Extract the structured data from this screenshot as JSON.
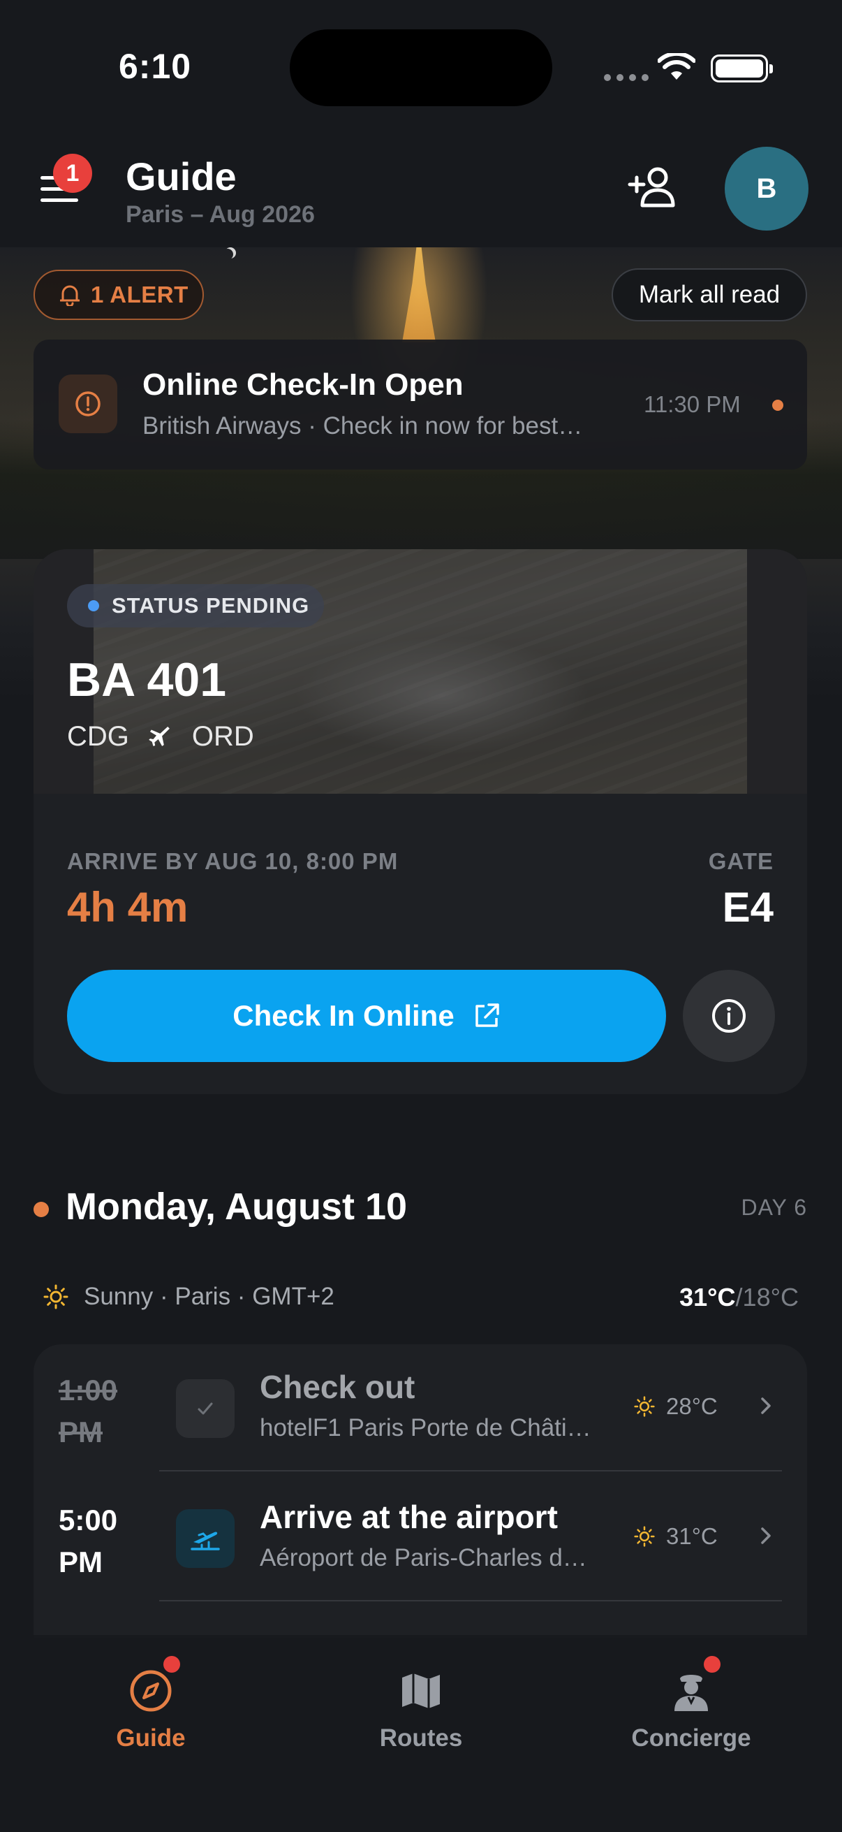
{
  "status_bar": {
    "time": "6:10"
  },
  "header": {
    "title": "Guide",
    "subtitle": "Paris – Aug 2026",
    "menu_badge": "1",
    "avatar_initial": "B"
  },
  "alerts": {
    "pill_label": "1 ALERT",
    "mark_all_label": "Mark all read"
  },
  "notification": {
    "title": "Online Check-In Open",
    "subtitle": "British Airways · Check in now for best…",
    "time": "11:30 PM",
    "dot_color": "#e57f45"
  },
  "flight": {
    "status": "STATUS PENDING",
    "flight_number": "BA 401",
    "origin": "CDG",
    "destination": "ORD",
    "arrive_label": "ARRIVE BY AUG 10, 8:00 PM",
    "countdown": "4h 4m",
    "gate_label": "GATE",
    "gate": "E4",
    "checkin_label": "Check In Online"
  },
  "day": {
    "title": "Monday, August 10",
    "day_label": "DAY 6",
    "weather": "Sunny · Paris · GMT+2",
    "high": "31°C",
    "low": "/18°C"
  },
  "itinerary": [
    {
      "time": "1:00 PM",
      "title": "Check out",
      "subtitle": "hotelF1 Paris Porte de Châti…",
      "temp": "28°C",
      "done": true,
      "icon": "check-icon"
    },
    {
      "time": "5:00 PM",
      "title": "Arrive at the airport",
      "subtitle": "Aéroport de Paris-Charles d…",
      "temp": "31°C",
      "done": false,
      "icon": "airport-departure-icon"
    }
  ],
  "bottom_nav": [
    {
      "label": "Guide",
      "icon": "compass-icon",
      "active": true,
      "badge": true
    },
    {
      "label": "Routes",
      "icon": "map-icon",
      "active": false,
      "badge": false
    },
    {
      "label": "Concierge",
      "icon": "concierge-icon",
      "active": false,
      "badge": true
    }
  ],
  "colors": {
    "accent": "#e57f45",
    "primary_button": "#0aa3f0",
    "background": "#17191d",
    "card": "#1e2024",
    "badge": "#e8403c"
  }
}
